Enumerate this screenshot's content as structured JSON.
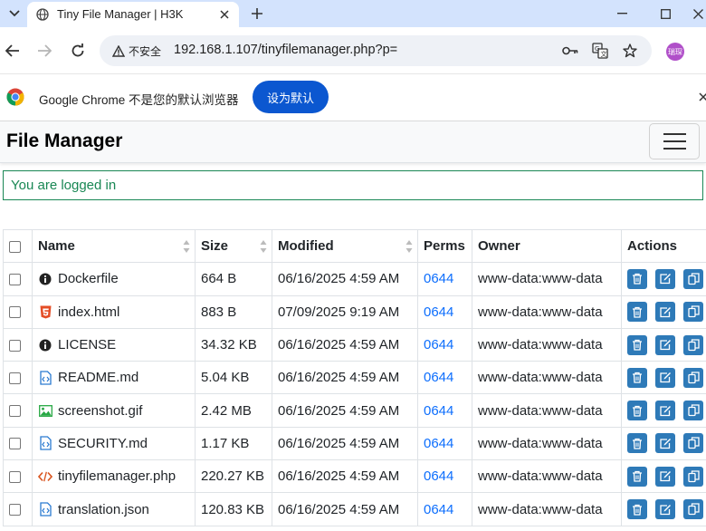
{
  "browser": {
    "tab_title": "Tiny File Manager | H3K",
    "security_label": "不安全",
    "url": "192.168.1.107/tinyfilemanager.php?p=",
    "avatar_text": "瑞琛",
    "infobar_text": "Google Chrome 不是您的默认浏览器",
    "infobar_button": "设为默认"
  },
  "app": {
    "brand": "File Manager",
    "alert": "You are logged in"
  },
  "table": {
    "headers": [
      "Name",
      "Size",
      "Modified",
      "Perms",
      "Owner",
      "Actions"
    ],
    "rows": [
      {
        "name": "Dockerfile",
        "icon": "info-icon",
        "size": "664 B",
        "modified": "06/16/2025 4:59 AM",
        "perms": "0644",
        "owner": "www-data:www-data"
      },
      {
        "name": "index.html",
        "icon": "html5-icon",
        "size": "883 B",
        "modified": "07/09/2025 9:19 AM",
        "perms": "0644",
        "owner": "www-data:www-data"
      },
      {
        "name": "LICENSE",
        "icon": "info-icon",
        "size": "34.32 KB",
        "modified": "06/16/2025 4:59 AM",
        "perms": "0644",
        "owner": "www-data:www-data"
      },
      {
        "name": "README.md",
        "icon": "code-file-icon",
        "size": "5.04 KB",
        "modified": "06/16/2025 4:59 AM",
        "perms": "0644",
        "owner": "www-data:www-data"
      },
      {
        "name": "screenshot.gif",
        "icon": "image-icon",
        "size": "2.42 MB",
        "modified": "06/16/2025 4:59 AM",
        "perms": "0644",
        "owner": "www-data:www-data"
      },
      {
        "name": "SECURITY.md",
        "icon": "code-file-icon",
        "size": "1.17 KB",
        "modified": "06/16/2025 4:59 AM",
        "perms": "0644",
        "owner": "www-data:www-data"
      },
      {
        "name": "tinyfilemanager.php",
        "icon": "code-icon",
        "size": "220.27 KB",
        "modified": "06/16/2025 4:59 AM",
        "perms": "0644",
        "owner": "www-data:www-data"
      },
      {
        "name": "translation.json",
        "icon": "code-file-icon",
        "size": "120.83 KB",
        "modified": "06/16/2025 4:59 AM",
        "perms": "0644",
        "owner": "www-data:www-data"
      }
    ]
  },
  "colors": {
    "accent": "#0b57d0",
    "alert_green": "#198754",
    "perm_link": "#0d6efd",
    "action_button": "#2e7ab8"
  }
}
